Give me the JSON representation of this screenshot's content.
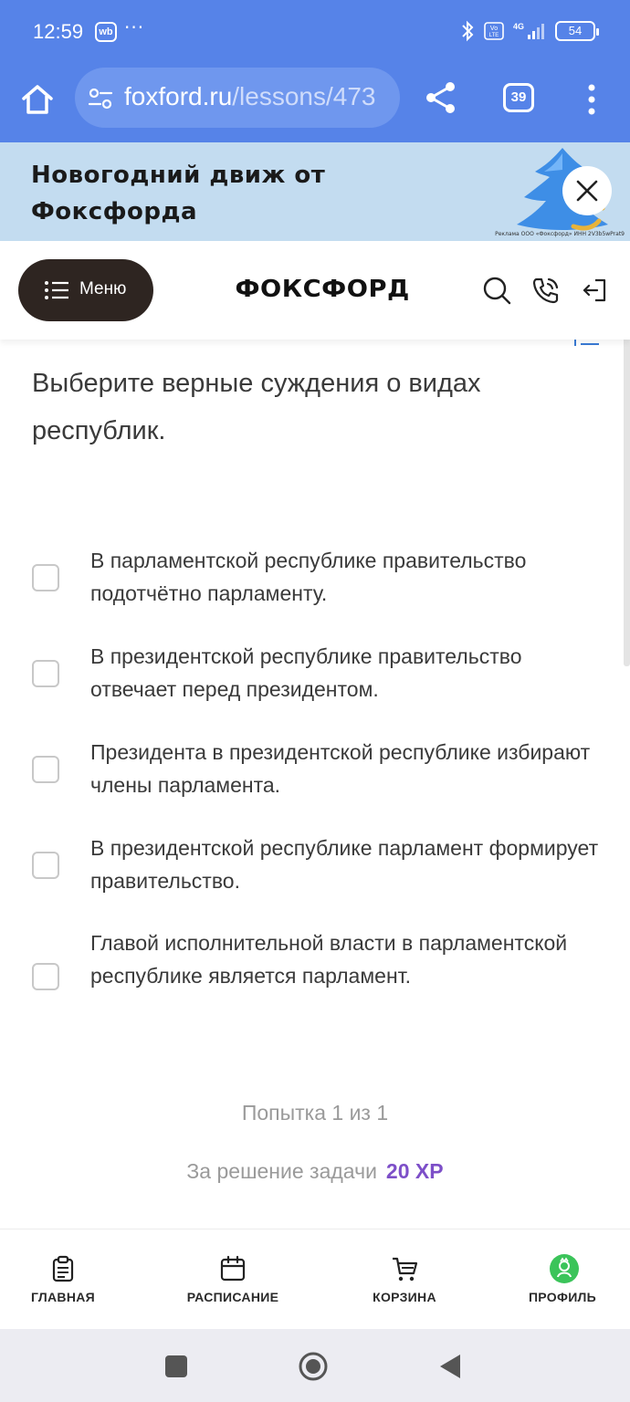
{
  "status_bar": {
    "time": "12:59",
    "app_badge": "wb",
    "overflow": "···",
    "battery": "54",
    "network": "4G",
    "volte": "Vo LTE"
  },
  "browser": {
    "url_host": "foxford.ru",
    "url_path": "/lessons/473",
    "tabs_count": "39",
    "accent_color": "#5683e8"
  },
  "banner": {
    "title_line1": "Новогодний движ от",
    "title_line2": "Фоксфорда",
    "ad_note": "Реклама ООО «Фоксфорд» ИНН 2V3b5wPrat9"
  },
  "header": {
    "menu_label": "Меню",
    "logo": "ФОКСФОРД"
  },
  "task": {
    "question": "Выберите верные суждения о видах республик.",
    "options": [
      {
        "text": "В парламентской республике правительство подотчётно парламенту.",
        "checked": false
      },
      {
        "text": "В президентской республике правительство отвечает перед президентом.",
        "checked": false
      },
      {
        "text": "Президента в президентской республике избирают члены парламента.",
        "checked": false
      },
      {
        "text": "В президентской республике парламент формирует правительство.",
        "checked": false
      },
      {
        "text": "Главой исполнительной власти в парламентской республике является парламент.",
        "checked": false
      }
    ],
    "attempt": "Попытка 1 из 1",
    "reward_label": "За решение задачи",
    "reward_xp": "20 XP",
    "xp_color": "#7d4fc8"
  },
  "bottom_nav": {
    "items": [
      {
        "label": "ГЛАВНАЯ",
        "icon": "clipboard-icon"
      },
      {
        "label": "РАСПИСАНИЕ",
        "icon": "calendar-icon"
      },
      {
        "label": "КОРЗИНА",
        "icon": "cart-icon"
      },
      {
        "label": "ПРОФИЛЬ",
        "icon": "profile-avatar-icon"
      }
    ]
  }
}
